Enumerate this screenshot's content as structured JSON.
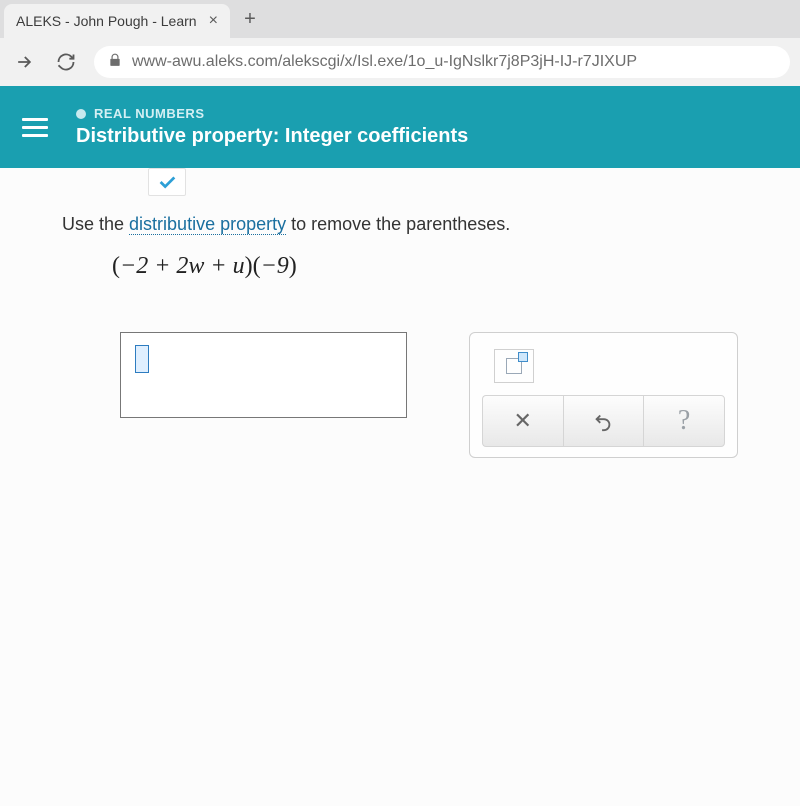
{
  "browser": {
    "tab_title": "ALEKS - John Pough - Learn",
    "url": "www-awu.aleks.com/alekscgi/x/Isl.exe/1o_u-IgNslkr7j8P3jH-IJ-r7JIXUP"
  },
  "topic": {
    "category": "REAL NUMBERS",
    "title": "Distributive property: Integer coefficients"
  },
  "question": {
    "instruction_pre": "Use the ",
    "instruction_link": "distributive property",
    "instruction_post": " to remove the parentheses.",
    "expression": "(−2 + 2w + u)(−9)"
  },
  "tools": {
    "exponent_label": "exponent",
    "clear_label": "clear",
    "undo_label": "undo",
    "help_label": "help"
  }
}
